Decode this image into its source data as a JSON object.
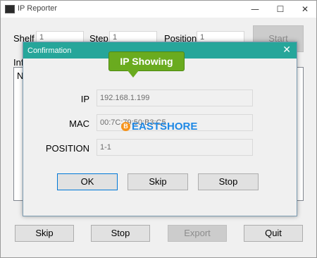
{
  "window": {
    "title": "IP Reporter",
    "min": "—",
    "max": "☐",
    "close": "✕"
  },
  "header": {
    "shelf_label": "Shelf",
    "shelf_value": "1",
    "step_label": "Step",
    "step_value": "1",
    "position_label": "Position",
    "position_value": "1",
    "start_label": "Start"
  },
  "info": {
    "label_partial": "Inf",
    "list_first_partial": "N"
  },
  "footer": {
    "skip_label": "Skip",
    "stop_label": "Stop",
    "export_label": "Export",
    "quit_label": "Quit"
  },
  "dialog": {
    "title": "Confirmation",
    "close": "✕",
    "fields": {
      "ip_label": "IP",
      "ip_value": "192.168.1.199",
      "mac_label": "MAC",
      "mac_value": "00:7C:79:50:B3:C5",
      "position_label": "POSITION",
      "position_value": "1-1"
    },
    "ok_label": "OK",
    "skip_label": "Skip",
    "stop_label": "Stop"
  },
  "overlay": {
    "callout_text": "IP Showing",
    "watermark_symbol": "B",
    "watermark_text": "EASTSHORE"
  },
  "colors": {
    "dialog_title_bg": "#26a69a",
    "callout_bg": "#6aab1f",
    "watermark": "#1e88e5"
  }
}
